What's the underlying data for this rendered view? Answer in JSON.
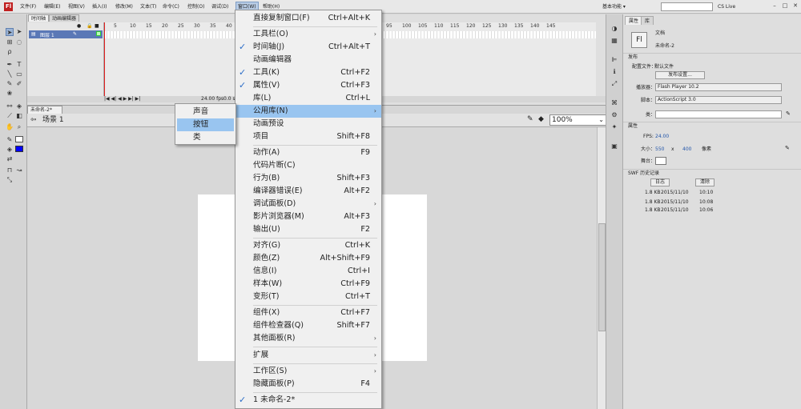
{
  "menubar": {
    "logo": "Fl",
    "items": [
      "文件(F)",
      "编辑(E)",
      "视图(V)",
      "插入(I)",
      "修改(M)",
      "文本(T)",
      "命令(C)",
      "控制(O)",
      "调试(D)",
      "窗口(W)",
      "帮助(H)"
    ],
    "workspace": "基本功能 ▾",
    "cslive": "CS Live"
  },
  "timeline": {
    "tabs": [
      "时间轴",
      "动画编辑器"
    ],
    "layer_name": "图层 1",
    "ruler": [
      "5",
      "10",
      "15",
      "20",
      "25",
      "30",
      "35",
      "40",
      "45",
      "50",
      "95",
      "100",
      "105",
      "110",
      "115",
      "120",
      "125",
      "130",
      "135",
      "140",
      "145"
    ],
    "footer_fps": "24.00 fps",
    "footer_time": "0.0 s"
  },
  "document": {
    "tab": "未命名-2*",
    "scene": "场景 1",
    "zoom": "100%"
  },
  "window_menu": {
    "items": [
      {
        "label": "直接复制窗口(F)",
        "shortcut": "Ctrl+Alt+K"
      },
      {
        "label": "工具栏(O)",
        "submenu": true
      },
      {
        "label": "时间轴(J)",
        "shortcut": "Ctrl+Alt+T",
        "checked": true
      },
      {
        "label": "动画编辑器"
      },
      {
        "label": "工具(K)",
        "shortcut": "Ctrl+F2",
        "checked": true
      },
      {
        "label": "属性(V)",
        "shortcut": "Ctrl+F3",
        "checked": true
      },
      {
        "label": "库(L)",
        "shortcut": "Ctrl+L"
      },
      {
        "label": "公用库(N)",
        "submenu": true,
        "highlighted": true
      },
      {
        "label": "动画预设"
      },
      {
        "label": "项目",
        "shortcut": "Shift+F8"
      },
      {
        "label": "动作(A)",
        "shortcut": "F9"
      },
      {
        "label": "代码片断(C)"
      },
      {
        "label": "行为(B)",
        "shortcut": "Shift+F3"
      },
      {
        "label": "编译器错误(E)",
        "shortcut": "Alt+F2"
      },
      {
        "label": "调试面板(D)",
        "submenu": true
      },
      {
        "label": "影片浏览器(M)",
        "shortcut": "Alt+F3"
      },
      {
        "label": "输出(U)",
        "shortcut": "F2"
      },
      {
        "label": "对齐(G)",
        "shortcut": "Ctrl+K"
      },
      {
        "label": "颜色(Z)",
        "shortcut": "Alt+Shift+F9"
      },
      {
        "label": "信息(I)",
        "shortcut": "Ctrl+I"
      },
      {
        "label": "样本(W)",
        "shortcut": "Ctrl+F9"
      },
      {
        "label": "变形(T)",
        "shortcut": "Ctrl+T"
      },
      {
        "label": "组件(X)",
        "shortcut": "Ctrl+F7"
      },
      {
        "label": "组件检查器(Q)",
        "shortcut": "Shift+F7"
      },
      {
        "label": "其他面板(R)",
        "submenu": true
      },
      {
        "label": "扩展",
        "submenu": true
      },
      {
        "label": "工作区(S)",
        "submenu": true
      },
      {
        "label": "隐藏面板(P)",
        "shortcut": "F4"
      },
      {
        "label": "1 未命名-2*",
        "checked": true
      }
    ]
  },
  "library_submenu": {
    "items": [
      "声音",
      "按钮",
      "类"
    ],
    "highlighted": "按钮"
  },
  "properties": {
    "tabs": [
      "属性",
      "库"
    ],
    "doc_icon": "Fl",
    "doc_type": "文档",
    "doc_name": "未命名-2",
    "sec_publish": "发布",
    "profile_label": "配置文件：",
    "profile_value": "默认文件",
    "publish_settings": "发布设置...",
    "player_label": "播放器：",
    "player_value": "Flash Player 10.2",
    "script_label": "脚本：",
    "script_value": "ActionScript 3.0",
    "class_label": "类：",
    "sec_props": "属性",
    "fps_label": "FPS:",
    "fps_value": "24.00",
    "size_label": "大小：",
    "width": "550",
    "x": "x",
    "height": "400",
    "unit": "像素",
    "stage_label": "舞台：",
    "sec_history": "SWF 历史记录",
    "log_btn": "日志",
    "clear_btn": "清除",
    "history": [
      [
        "1.8 KB",
        "2015/11/10",
        "10:10"
      ],
      [
        "1.8 KB",
        "2015/11/10",
        "10:08"
      ],
      [
        "1.8 KB",
        "2015/11/10",
        "10:06"
      ]
    ]
  },
  "colors": {
    "menu_highlight": "#99c5f0",
    "check": "#2a6cc7",
    "layer_selected": "#5a78b6",
    "playhead": "#e02020"
  }
}
